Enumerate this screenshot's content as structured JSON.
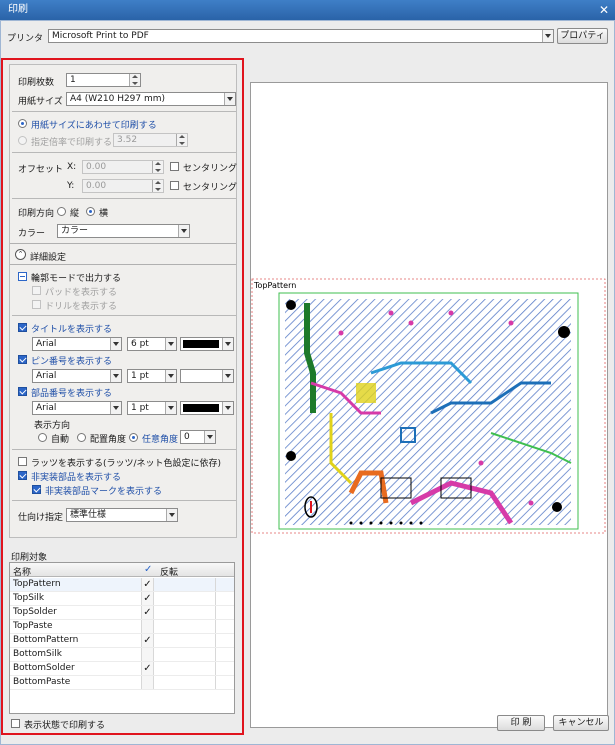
{
  "window": {
    "title": "印刷"
  },
  "printer": {
    "label": "プリンタ",
    "value": "Microsoft Print to PDF",
    "properties_button": "プロパティ"
  },
  "settings": {
    "copies_label": "印刷枚数",
    "copies_value": "1",
    "paper_size_label": "用紙サイズ",
    "paper_size_value": "A4 (W210 H297 mm)",
    "fit_to_paper_label": "用紙サイズにあわせて印刷する",
    "scale_label": "指定倍率で印刷する",
    "scale_value": "3.52",
    "offset_label": "オフセット",
    "offset_x_label": "X:",
    "offset_x_value": "0.00",
    "offset_y_label": "Y:",
    "offset_y_value": "0.00",
    "centering_label": "センタリング",
    "orientation_label": "印刷方向",
    "portrait_label": "縦",
    "landscape_label": "横",
    "color_label": "カラー",
    "color_value": "カラー",
    "detail_label": "詳細設定",
    "outline_mode_label": "輪郭モードで出力する",
    "show_pads_label": "パッドを表示する",
    "show_drills_label": "ドリルを表示する",
    "show_title_label": "タイトルを表示する",
    "title_font": "Arial",
    "title_size": "6 pt",
    "show_pin_label": "ピン番号を表示する",
    "pin_font": "Arial",
    "pin_size": "1 pt",
    "show_part_label": "部品番号を表示する",
    "part_font": "Arial",
    "part_size": "1 pt",
    "display_direction_label": "表示方向",
    "auto_label": "自動",
    "placement_angle_label": "配置角度",
    "any_angle_label": "任意角度",
    "angle_value": "0",
    "show_ratsnest_label": "ラッツを表示する(ラッツ/ネット色設定に依存)",
    "show_non_mounted_label": "非実装部品を表示する",
    "show_non_mounted_mark_label": "非実装部品マークを表示する",
    "destination_label": "仕向け指定",
    "destination_value": "標準仕様"
  },
  "colors": {
    "title": "#000000",
    "pin": "#ffffff",
    "part": "#000000"
  },
  "print_target": {
    "label": "印刷対象",
    "columns": [
      "名称",
      "✓",
      "反転"
    ],
    "rows": [
      {
        "name": "TopPattern",
        "check": "✓"
      },
      {
        "name": "TopSilk",
        "check": "✓"
      },
      {
        "name": "TopSolder",
        "check": "✓"
      },
      {
        "name": "TopPaste",
        "check": ""
      },
      {
        "name": "BottomPattern",
        "check": "✓"
      },
      {
        "name": "BottomSilk",
        "check": ""
      },
      {
        "name": "BottomSolder",
        "check": "✓"
      },
      {
        "name": "BottomPaste",
        "check": ""
      }
    ]
  },
  "print_display_state_label": "表示状態で印刷する",
  "preview": {
    "title_text": "TopPattern"
  },
  "footer": {
    "print_button": "印 刷",
    "cancel_button": "キャンセル"
  }
}
